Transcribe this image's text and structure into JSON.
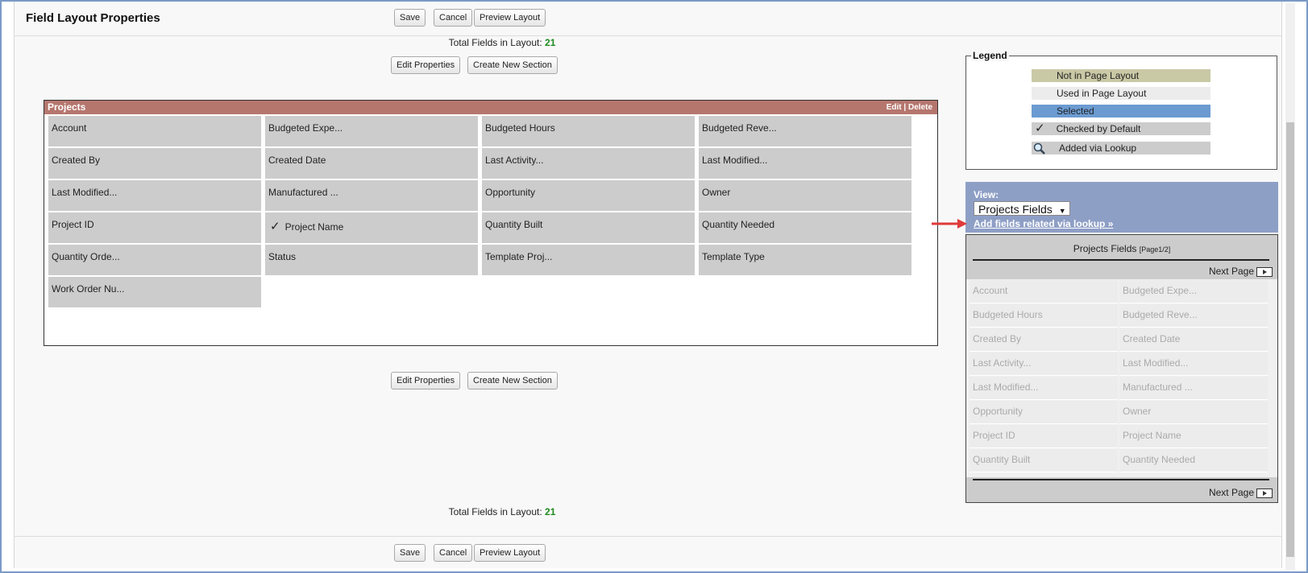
{
  "header": {
    "title": "Field Layout Properties",
    "save_label": "Save",
    "cancel_label": "Cancel",
    "preview_label": "Preview Layout"
  },
  "total": {
    "label": "Total Fields in Layout:",
    "count": "21"
  },
  "actions": {
    "edit_properties_label": "Edit Properties",
    "create_section_label": "Create New Section"
  },
  "section": {
    "title": "Projects",
    "edit_label": "Edit",
    "separator": "|",
    "delete_label": "Delete",
    "fields": [
      "Account",
      "Budgeted Expe...",
      "Budgeted Hours",
      "Budgeted Reve...",
      "Created By",
      "Created Date",
      "Last Activity...",
      "Last Modified...",
      "Last Modified...",
      "Manufactured ...",
      "Opportunity",
      "Owner",
      "Project ID",
      "Project Name",
      "Quantity Built",
      "Quantity Needed",
      "Quantity Orde...",
      "Status",
      "Template Proj...",
      "Template Type",
      "Work Order Nu..."
    ]
  },
  "legend": {
    "title": "Legend",
    "items": [
      {
        "label": "Not in Page Layout",
        "color": "#c9c9a6"
      },
      {
        "label": "Used in Page Layout",
        "color": "#ececec"
      },
      {
        "label": "Selected",
        "color": "#6b9bd1"
      },
      {
        "label": "Checked by Default",
        "color": "#cccccc"
      },
      {
        "label": "Added via Lookup",
        "color": "#cccccc"
      }
    ]
  },
  "view": {
    "label": "View:",
    "selected": "Projects Fields",
    "lookup_link": "Add fields related via lookup »"
  },
  "palette": {
    "title": "Projects Fields",
    "page_indicator": "[Page1/2]",
    "next_label": "Next Page",
    "fields": [
      "Account",
      "Budgeted Expe...",
      "Budgeted Hours",
      "Budgeted Reve...",
      "Created By",
      "Created Date",
      "Last Activity...",
      "Last Modified...",
      "Last Modified...",
      "Manufactured ...",
      "Opportunity",
      "Owner",
      "Project ID",
      "Project Name",
      "Quantity Built",
      "Quantity Needed"
    ]
  },
  "colors": {
    "section_header": "#b5766e",
    "view_panel": "#8e9fc6",
    "field_cell": "#cccccc",
    "count": "#1d8a1d",
    "arrow": "#e03a3a"
  }
}
